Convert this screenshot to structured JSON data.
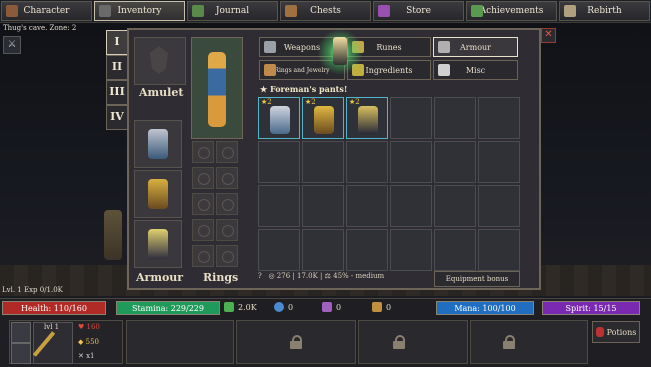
{
  "topnav": [
    {
      "label": "Character",
      "icon": "character-icon",
      "color": "#8a5a3a"
    },
    {
      "label": "Inventory",
      "icon": "inventory-icon",
      "color": "#6a6a6a"
    },
    {
      "label": "Journal",
      "icon": "journal-icon",
      "color": "#5a8a4a"
    },
    {
      "label": "Chests",
      "icon": "chest-icon",
      "color": "#a07040"
    },
    {
      "label": "Store",
      "icon": "store-icon",
      "color": "#9a50b0"
    },
    {
      "label": "Achievements",
      "icon": "achievements-icon",
      "color": "#5a9a50"
    },
    {
      "label": "Rebirth",
      "icon": "rebirth-icon",
      "color": "#b0a080"
    }
  ],
  "world": {
    "zone": "Thug's cave. Zone: 2",
    "level": "Lvl. 1 Exp 0/1.0K"
  },
  "tiers": [
    "I",
    "II",
    "III",
    "IV"
  ],
  "equipment": {
    "amulet_label": "Amulet",
    "armour_label": "Armour",
    "rings_label": "Rings"
  },
  "categories": [
    {
      "label": "Weapons",
      "icon": "weapon-icon",
      "color": "#9aa0a8"
    },
    {
      "label": "Runes",
      "icon": "rune-icon",
      "color": "#c0a84a"
    },
    {
      "label": "Armour",
      "icon": "armour-icon",
      "color": "#b0b0b0"
    },
    {
      "label": "Rings and Jewelry",
      "icon": "ring-icon",
      "color": "#c08a4a"
    },
    {
      "label": "Ingredients",
      "icon": "ingredient-icon",
      "color": "#c0b040"
    },
    {
      "label": "Misc",
      "icon": "misc-icon",
      "color": "#d0d0d0"
    }
  ],
  "new_item": "Foreman's pants!",
  "items": [
    {
      "tier": "2",
      "color": "#4a6a8a"
    },
    {
      "tier": "2",
      "color": "#c8a030"
    },
    {
      "tier": "2",
      "color": "#8a8aa0"
    }
  ],
  "status": {
    "count": "276",
    "weight": "17.0K",
    "percent": "45% - medium"
  },
  "equipment_bonus": "Equipment bonus",
  "bars": {
    "health": "Health: 110/160",
    "stamina": "Stamina: 229/229",
    "mana": "Mana: 100/100",
    "spirit": "Spirit: 15/15"
  },
  "resources": [
    {
      "icon": "gold-icon",
      "value": "2.0K",
      "color": "#4ab050"
    },
    {
      "icon": "orb-icon",
      "value": "0",
      "color": "#4a8ad0"
    },
    {
      "icon": "gem-icon",
      "value": "0",
      "color": "#a060c0"
    },
    {
      "icon": "fragment-icon",
      "value": "0",
      "color": "#c09040"
    }
  ],
  "weapon": {
    "level": "lvl 1",
    "hp": "160",
    "gold": "550",
    "mult": "x1"
  },
  "potions": "Potions"
}
